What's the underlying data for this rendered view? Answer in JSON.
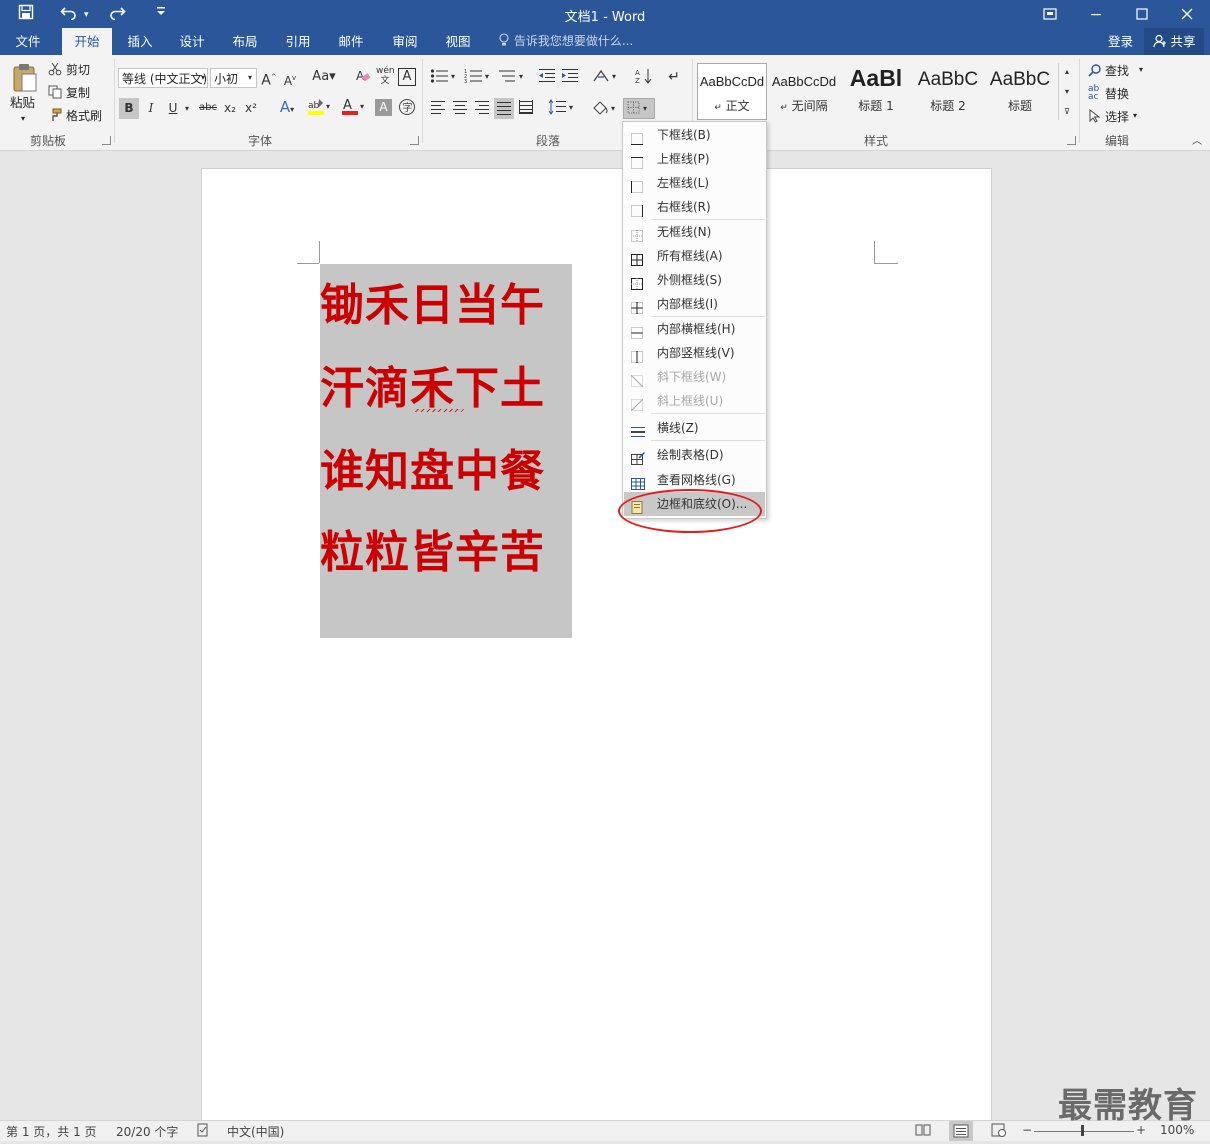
{
  "window": {
    "title": "文档1 - Word"
  },
  "tabs": [
    {
      "label": "文件"
    },
    {
      "label": "开始"
    },
    {
      "label": "插入"
    },
    {
      "label": "设计"
    },
    {
      "label": "布局"
    },
    {
      "label": "引用"
    },
    {
      "label": "邮件"
    },
    {
      "label": "审阅"
    },
    {
      "label": "视图"
    }
  ],
  "tell_me": {
    "placeholder": "告诉我您想要做什么..."
  },
  "account": {
    "sign_in": "登录",
    "share": "共享"
  },
  "clipboard": {
    "paste": "粘贴",
    "cut": "剪切",
    "copy": "复制",
    "format_painter": "格式刷",
    "group_label": "剪贴板"
  },
  "font": {
    "name": "等线 (中文正文)",
    "size": "小初",
    "group_label": "字体",
    "bold": "B",
    "italic": "I",
    "underline": "U",
    "strike": "abc",
    "sub": "x₂",
    "sup": "x²"
  },
  "paragraph": {
    "group_label": "段落"
  },
  "styles": {
    "group_label": "样式",
    "items": [
      {
        "preview": "AaBbCcDd",
        "name": "正文"
      },
      {
        "preview": "AaBbCcDd",
        "name": "无间隔"
      },
      {
        "preview": "AaBl",
        "name": "标题 1"
      },
      {
        "preview": "AaBbC",
        "name": "标题 2"
      },
      {
        "preview": "AaBbC",
        "name": "标题"
      }
    ]
  },
  "editing": {
    "find": "查找",
    "replace": "替换",
    "select": "选择",
    "group_label": "编辑"
  },
  "document": {
    "lines": [
      "锄禾日当午",
      "汗滴禾下土",
      "谁知盘中餐",
      "粒粒皆辛苦"
    ]
  },
  "border_menu": {
    "items": [
      {
        "label": "下框线(B)",
        "icon": "bottom-border-icon"
      },
      {
        "label": "上框线(P)",
        "icon": "top-border-icon"
      },
      {
        "label": "左框线(L)",
        "icon": "left-border-icon"
      },
      {
        "label": "右框线(R)",
        "icon": "right-border-icon"
      },
      {
        "label": "无框线(N)",
        "icon": "no-border-icon"
      },
      {
        "label": "所有框线(A)",
        "icon": "all-borders-icon"
      },
      {
        "label": "外侧框线(S)",
        "icon": "outside-borders-icon"
      },
      {
        "label": "内部框线(I)",
        "icon": "inside-borders-icon"
      },
      {
        "label": "内部横框线(H)",
        "icon": "inside-horizontal-border-icon"
      },
      {
        "label": "内部竖框线(V)",
        "icon": "inside-vertical-border-icon"
      },
      {
        "label": "斜下框线(W)",
        "icon": "diagonal-down-border-icon"
      },
      {
        "label": "斜上框线(U)",
        "icon": "diagonal-up-border-icon"
      },
      {
        "label": "横线(Z)",
        "icon": "horizontal-line-icon"
      },
      {
        "label": "绘制表格(D)",
        "icon": "draw-table-icon"
      },
      {
        "label": "查看网格线(G)",
        "icon": "view-gridlines-icon"
      },
      {
        "label": "边框和底纹(O)...",
        "icon": "borders-and-shading-icon"
      }
    ]
  },
  "status": {
    "page": "第 1 页，共 1 页",
    "words": "20/20 个字",
    "language": "中文(中国)",
    "zoom": "100%"
  },
  "watermark": "最需教育",
  "colors": {
    "brand": "#2b579a",
    "poem_text": "#cc0000",
    "shading": "#c6c6c6",
    "annotation": "#e31d1d"
  }
}
